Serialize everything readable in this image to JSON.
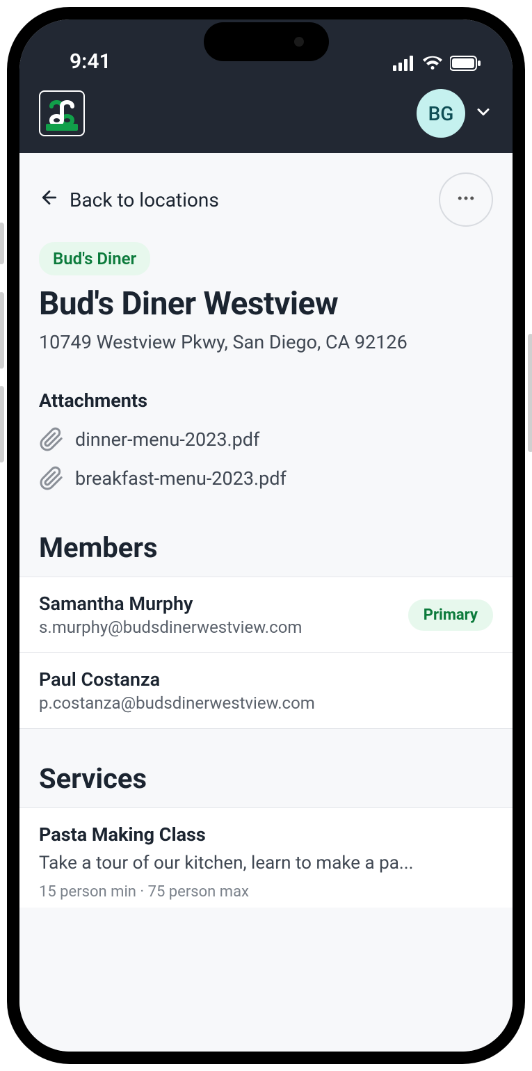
{
  "status": {
    "time": "9:41"
  },
  "header": {
    "avatar_initials": "BG"
  },
  "nav": {
    "back_label": "Back to locations"
  },
  "location": {
    "tag": "Bud's Diner",
    "title": "Bud's Diner Westview",
    "address": "10749 Westview Pkwy, San Diego, CA 92126"
  },
  "attachments": {
    "heading": "Attachments",
    "items": [
      {
        "filename": "dinner-menu-2023.pdf"
      },
      {
        "filename": "breakfast-menu-2023.pdf"
      }
    ]
  },
  "members": {
    "heading": "Members",
    "primary_label": "Primary",
    "items": [
      {
        "name": "Samantha Murphy",
        "email": "s.murphy@budsdinerwestview.com",
        "primary": true
      },
      {
        "name": "Paul Costanza",
        "email": "p.costanza@budsdinerwestview.com",
        "primary": false
      }
    ]
  },
  "services": {
    "heading": "Services",
    "items": [
      {
        "name": "Pasta Making Class",
        "desc": "Take a tour of our kitchen, learn to make a pa...",
        "meta": "15 person min · 75 person max"
      }
    ]
  }
}
